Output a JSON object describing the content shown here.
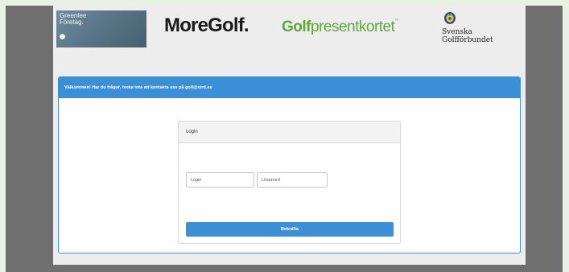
{
  "header": {
    "greenfee_logo": {
      "line1": "Greenfee",
      "line2": "Företag.",
      "icon": "greenfee-mark-icon"
    },
    "moregolf_logo": "MoreGolf.",
    "presentkort_logo": {
      "bold": "Golf",
      "rest": "presentkortet",
      "tm": "™"
    },
    "sgf_logo": {
      "line1": "Svenska",
      "line2": "Golfförbundet",
      "icon": "crown-crest-icon"
    }
  },
  "panel": {
    "welcome_text": "Välkommen! Har du frågor, tveka inte att kontakta oss på golf@strd.se"
  },
  "login": {
    "card_title": "Login",
    "username_placeholder": "Login",
    "password_placeholder": "Lösenord",
    "confirm_label": "Bekräfta"
  },
  "colors": {
    "accent_blue": "#3b8fd6",
    "presentkort_green": "#5fa839",
    "outer_frame": "#6f6f6f",
    "page_background": "#ededed"
  }
}
